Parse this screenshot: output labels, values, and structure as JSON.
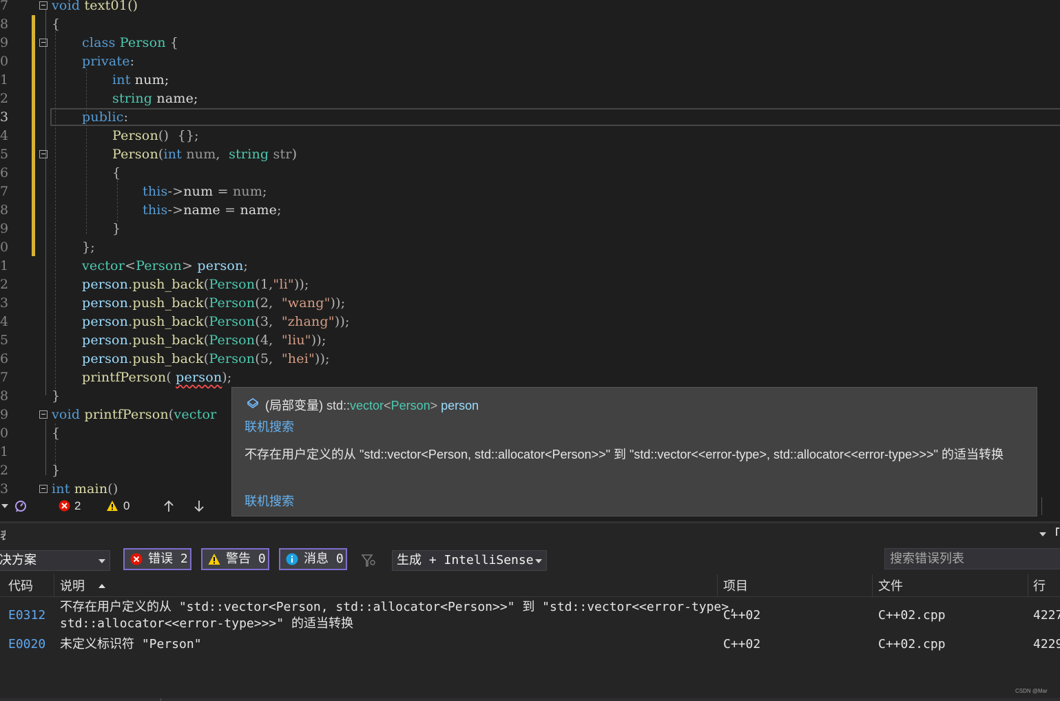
{
  "editor": {
    "lines": [
      {
        "n": "7",
        "cur": false
      },
      {
        "n": "8",
        "cur": false
      },
      {
        "n": "9",
        "cur": false
      },
      {
        "n": "0",
        "cur": false
      },
      {
        "n": "1",
        "cur": false
      },
      {
        "n": "2",
        "cur": false
      },
      {
        "n": "3",
        "cur": true
      },
      {
        "n": "4",
        "cur": false
      },
      {
        "n": "5",
        "cur": false
      },
      {
        "n": "6",
        "cur": false
      },
      {
        "n": "7",
        "cur": false
      },
      {
        "n": "8",
        "cur": false
      },
      {
        "n": "9",
        "cur": false
      },
      {
        "n": "0",
        "cur": false
      },
      {
        "n": "1",
        "cur": false
      },
      {
        "n": "2",
        "cur": false
      },
      {
        "n": "3",
        "cur": false
      },
      {
        "n": "4",
        "cur": false
      },
      {
        "n": "5",
        "cur": false
      },
      {
        "n": "6",
        "cur": false
      },
      {
        "n": "7",
        "cur": false
      },
      {
        "n": "8",
        "cur": false
      },
      {
        "n": "9",
        "cur": false
      },
      {
        "n": "0",
        "cur": false
      },
      {
        "n": "1",
        "cur": false
      },
      {
        "n": "2",
        "cur": false
      },
      {
        "n": "3",
        "cur": false
      }
    ],
    "code": {
      "l0": [
        "void",
        " text01()"
      ],
      "l1": "{",
      "l2": [
        "class",
        " ",
        "Person",
        " {"
      ],
      "l3": [
        "private",
        ":"
      ],
      "l4": [
        "int",
        " num;"
      ],
      "l5": [
        "string",
        " name;"
      ],
      "l6": [
        "public",
        ":"
      ],
      "l7": [
        "Person",
        "()  {};"
      ],
      "l8": [
        "Person",
        "(",
        "int",
        " ",
        "num",
        ",  ",
        "string",
        " ",
        "str",
        ")"
      ],
      "l9": "{",
      "l10": [
        "this",
        "->",
        "num",
        " = ",
        "num",
        ";"
      ],
      "l11": [
        "this",
        "->",
        "name",
        " = ",
        "name",
        ";"
      ],
      "l12": "}",
      "l13": "};",
      "l14": [
        "vector",
        "<",
        "Person",
        ">",
        " ",
        "person",
        ";"
      ],
      "l15": [
        "person",
        ".",
        "push_back",
        "(",
        "Person",
        "(1,",
        "\"li\"",
        "));"
      ],
      "l16": [
        "person",
        ".",
        "push_back",
        "(",
        "Person",
        "(2,  ",
        "\"wang\"",
        "));"
      ],
      "l17": [
        "person",
        ".",
        "push_back",
        "(",
        "Person",
        "(3,  ",
        "\"zhang\"",
        "));"
      ],
      "l18": [
        "person",
        ".",
        "push_back",
        "(",
        "Person",
        "(4,  ",
        "\"liu\"",
        "));"
      ],
      "l19": [
        "person",
        ".",
        "push_back",
        "(",
        "Person",
        "(5,  ",
        "\"hei\"",
        "));"
      ],
      "l20": [
        "printfPerson",
        "( ",
        "person",
        ");"
      ],
      "l21": "}",
      "l22": [
        "void",
        " ",
        "printfPerson",
        "(",
        "vector"
      ],
      "l23": "{",
      "l24": "",
      "l25": "}",
      "l26": [
        "int",
        " ",
        "main",
        "()"
      ]
    }
  },
  "status": {
    "errors": "2",
    "warnings": "0"
  },
  "tooltip": {
    "scope": "(局部变量)",
    "ns": "std::",
    "type": "vector",
    "lt": "<",
    "param": "Person",
    "gt": ">",
    "name": "person",
    "link1": "联机搜索",
    "message": "不存在用户定义的从 \"std::vector<Person, std::allocator<Person>>\" 到 \"std::vector<<error-type>, std::allocator<<error-type>>>\" 的适当转换",
    "link2": "联机搜索"
  },
  "errorlist": {
    "scope_combo": "决方案",
    "errors_btn": "错误 2",
    "warnings_btn": "警告 0",
    "messages_btn": "消息 0",
    "build_combo": "生成 + IntelliSense",
    "search_placeholder": "搜索错误列表",
    "columns": {
      "code": "代码",
      "desc": "说明",
      "project": "项目",
      "file": "文件",
      "line": "行"
    },
    "rows": [
      {
        "code": "E0312",
        "desc1": "不存在用户定义的从 \"std::vector<Person, std::allocator<Person>>\" 到 \"std::vector<<error-type>,",
        "desc2": "std::allocator<<error-type>>>\" 的适当转换",
        "project": "C++02",
        "file": "C++02.cpp",
        "line": "4227"
      },
      {
        "code": "E0020",
        "desc1": "未定义标识符 \"Person\"",
        "desc2": "",
        "project": "C++02",
        "file": "C++02.cpp",
        "line": "4229"
      }
    ],
    "panel_title": "表",
    "watermark": "CSDN @Mar"
  }
}
